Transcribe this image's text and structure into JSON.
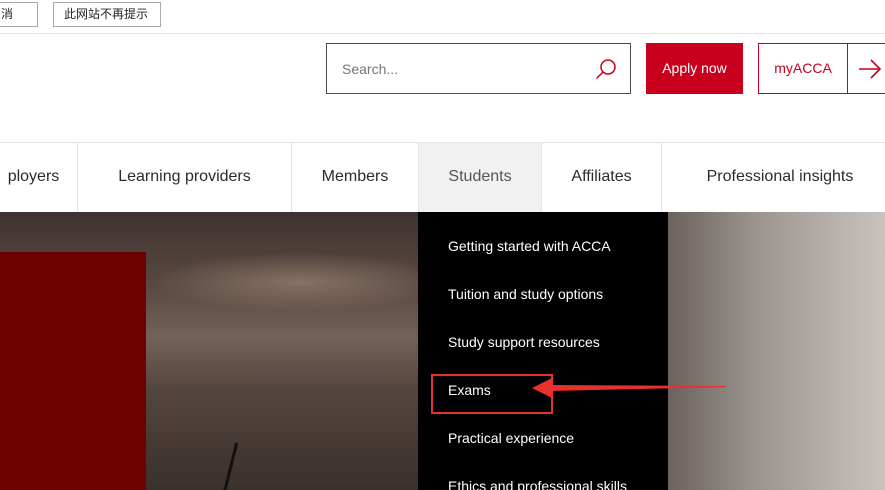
{
  "translate_bar": {
    "cancel_label": "消",
    "never_label": "此网站不再提示"
  },
  "header": {
    "search_placeholder": "Search...",
    "apply_label": "Apply now",
    "myacca_label": "myACCA"
  },
  "nav": {
    "items": [
      {
        "label": "ployers"
      },
      {
        "label": "Learning providers"
      },
      {
        "label": "Members"
      },
      {
        "label": "Students"
      },
      {
        "label": "Affiliates"
      },
      {
        "label": "Professional insights"
      }
    ],
    "active": "Students"
  },
  "dropdown": {
    "items": [
      {
        "label": "Getting started with ACCA"
      },
      {
        "label": "Tuition and study options"
      },
      {
        "label": "Study support resources"
      },
      {
        "label": "Exams"
      },
      {
        "label": "Practical experience"
      },
      {
        "label": "Ethics and professional skills"
      }
    ]
  },
  "colors": {
    "accent": "#c8001e",
    "annotation": "#e8312d"
  },
  "icons": {
    "search": "search-icon",
    "myacca_arrow": "arrow-right-icon"
  }
}
